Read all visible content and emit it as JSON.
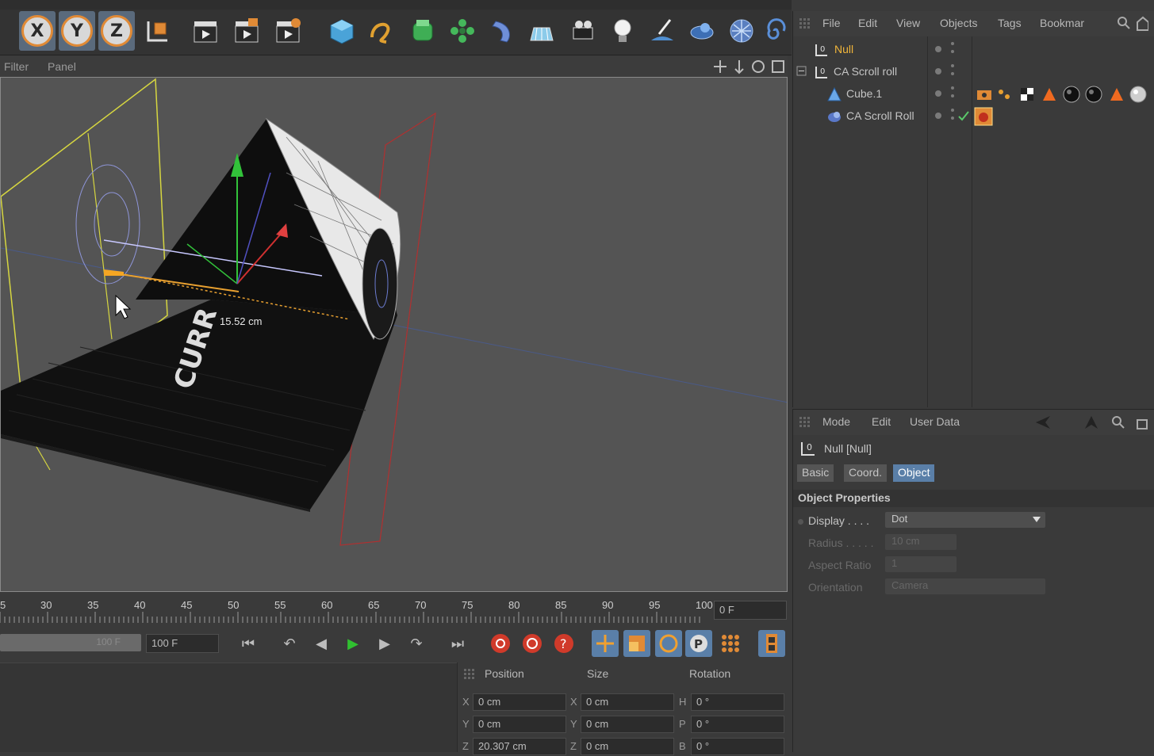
{
  "toolbar": {
    "axis_x": "X",
    "axis_y": "Y",
    "axis_z": "Z"
  },
  "viewport": {
    "menu_filter": "Filter",
    "menu_panel": "Panel",
    "measure_label": "15.52 cm",
    "text_on_object": "CURR"
  },
  "timeline": {
    "ticks": [
      "5",
      "30",
      "35",
      "40",
      "45",
      "50",
      "55",
      "60",
      "65",
      "70",
      "75",
      "80",
      "85",
      "90",
      "95",
      "100"
    ],
    "current_frame": "0 F"
  },
  "transport": {
    "range_end_slider": "100 F",
    "end_frame": "100 F"
  },
  "coords": {
    "header_position": "Position",
    "header_size": "Size",
    "header_rotation": "Rotation",
    "rows": [
      {
        "axis_p": "X",
        "pos": "0 cm",
        "axis_s": "X",
        "size": "0 cm",
        "axis_r": "H",
        "rot": "0 °"
      },
      {
        "axis_p": "Y",
        "pos": "0 cm",
        "axis_s": "Y",
        "size": "0 cm",
        "axis_r": "P",
        "rot": "0 °"
      },
      {
        "axis_p": "Z",
        "pos": "20.307 cm",
        "axis_s": "Z",
        "size": "0 cm",
        "axis_r": "B",
        "rot": "0 °"
      }
    ]
  },
  "object_manager": {
    "menu": [
      "File",
      "Edit",
      "View",
      "Objects",
      "Tags",
      "Bookmar"
    ],
    "objects": [
      {
        "name": "Null",
        "selected": true
      },
      {
        "name": "CA Scroll roll",
        "selected": false
      },
      {
        "name": "Cube.1",
        "selected": false
      },
      {
        "name": "CA Scroll Roll",
        "selected": false
      }
    ]
  },
  "attribute_manager": {
    "menu": [
      "Mode",
      "Edit",
      "User Data"
    ],
    "object_title": "Null [Null]",
    "tabs": [
      "Basic",
      "Coord.",
      "Object"
    ],
    "active_tab": "Object",
    "section": "Object Properties",
    "display_label": "Display . . . .",
    "display_value": "Dot",
    "radius_label": "Radius . . . . .",
    "radius_value": "10 cm",
    "aspect_label": "Aspect Ratio",
    "aspect_value": "1",
    "orientation_label": "Orientation",
    "orientation_value": "Camera"
  },
  "colors": {
    "accent_orange": "#e08a36",
    "active_tab_blue": "#5a7fa8",
    "selected_object": "#f0b53a"
  }
}
